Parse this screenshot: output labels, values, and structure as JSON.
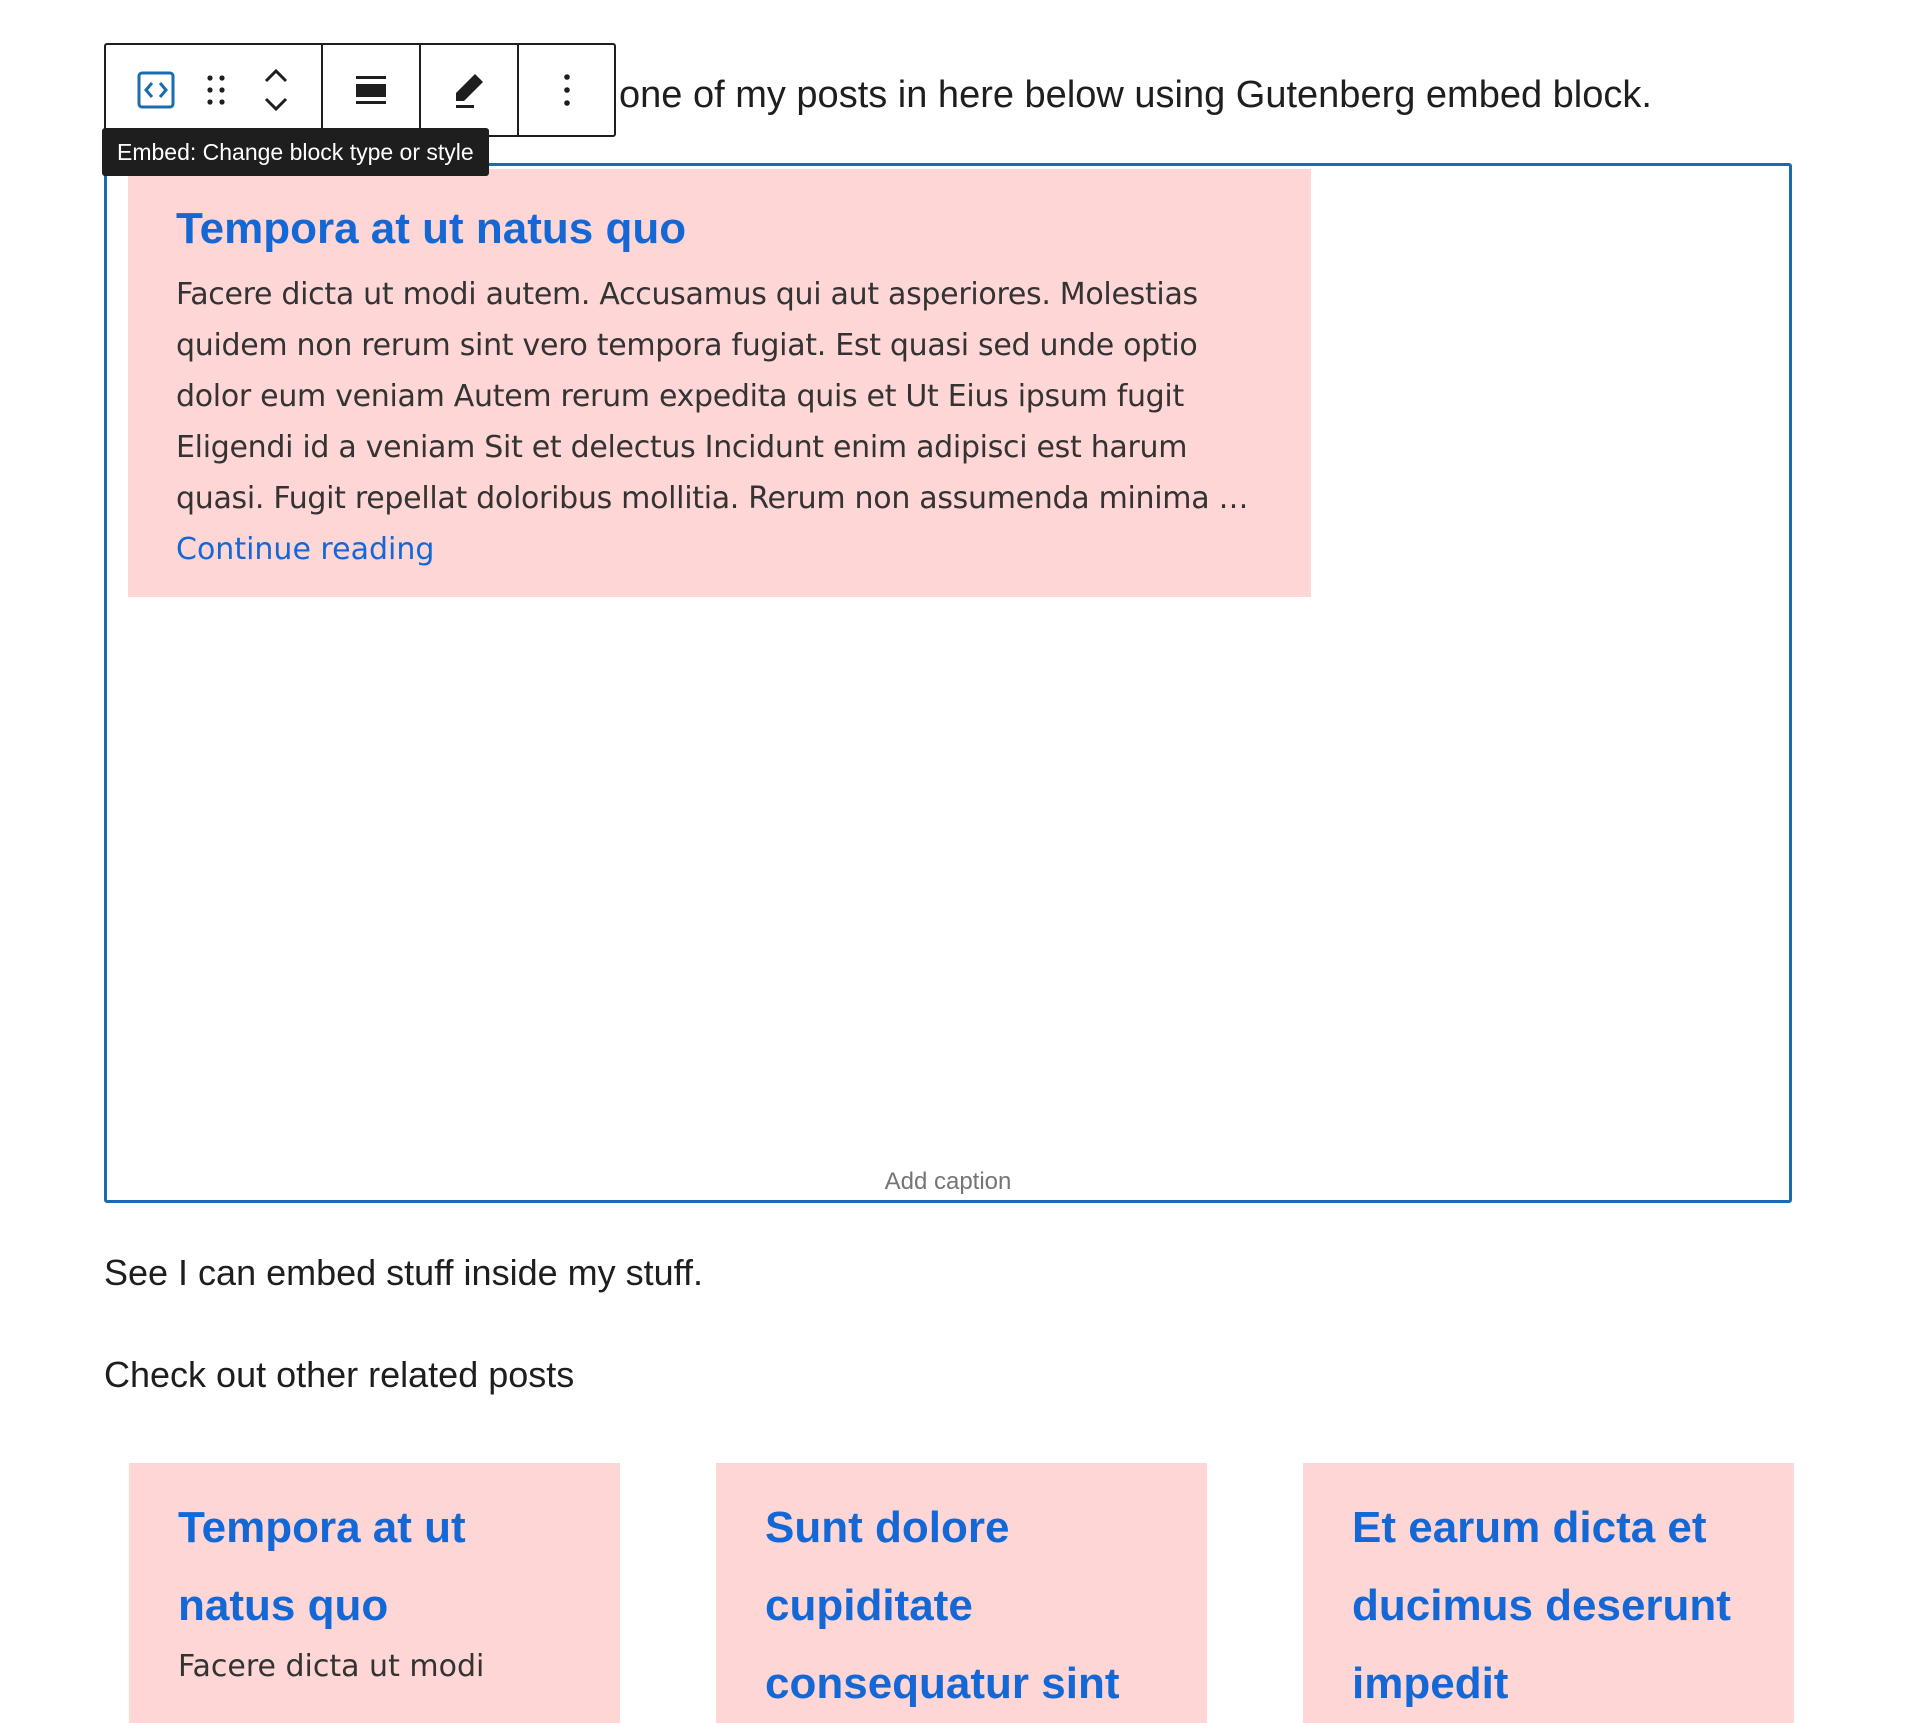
{
  "intro": {
    "text": "one of my posts in here below using Gutenberg embed block."
  },
  "toolbar": {
    "tooltip": "Embed: Change block type or style"
  },
  "embed": {
    "title": "Tempora at ut natus quo",
    "excerpt": "Facere dicta ut modi autem. Accusamus qui aut asperiores. Molestias quidem non rerum sint vero tempora fugiat. Est quasi sed unde optio dolor eum veniam Autem rerum expedita quis et Ut Eius ipsum fugit Eligendi id a veniam Sit et delectus Incidunt enim adipisci est harum quasi. Fugit repellat doloribus mollitia. Rerum non assumenda minima …",
    "link": "Continue reading",
    "caption_placeholder": "Add caption"
  },
  "paragraphs": {
    "p1": "See I can embed stuff inside my stuff.",
    "p2": "Check out other related posts"
  },
  "related": [
    {
      "title": "Tempora at ut natus quo",
      "excerpt": "Facere dicta ut modi"
    },
    {
      "title": "Sunt dolore cupiditate consequatur sint"
    },
    {
      "title": "Et earum dicta et ducimus deserunt impedit"
    }
  ],
  "colors": {
    "accent": "#1a6bb0",
    "link": "#1468d6",
    "card_bg": "#ffd6d6",
    "tooltip_bg": "#1e1e1e"
  }
}
